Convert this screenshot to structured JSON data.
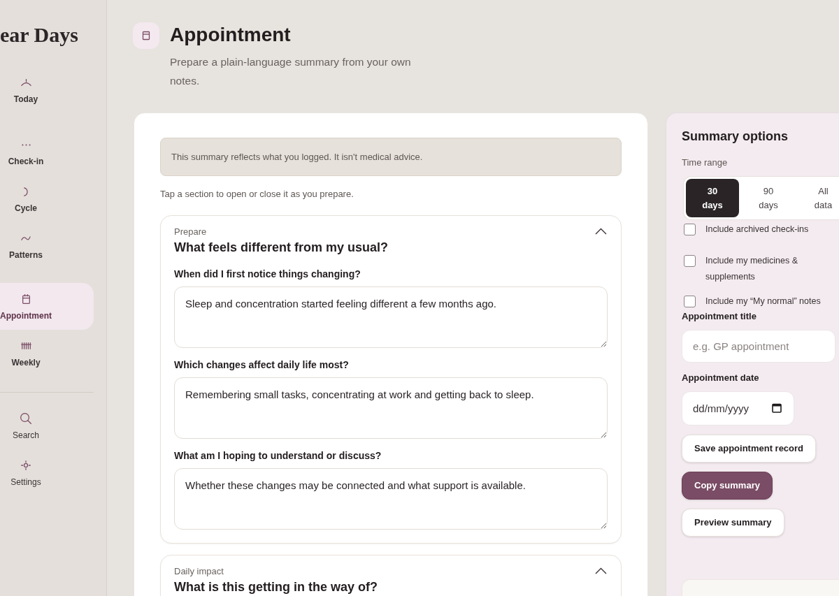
{
  "sidebar": {
    "logo": "ear Days",
    "items": [
      {
        "label": "Today",
        "selected": false
      },
      {
        "label": "Check-in",
        "selected": false
      },
      {
        "label": "Cycle",
        "selected": false
      },
      {
        "label": "Patterns",
        "selected": false
      },
      {
        "label": "Appointment",
        "selected": true
      },
      {
        "label": "Weekly",
        "selected": false
      }
    ],
    "footer_items": [
      {
        "label": "Search"
      },
      {
        "label": "Settings"
      }
    ]
  },
  "header": {
    "title": "Appointment",
    "subtitle": "Prepare a plain-language summary from your own notes."
  },
  "main": {
    "notice": "This summary reflects what you logged. It isn't medical advice.",
    "hint": "Tap a section to open or close it as you prepare.",
    "sections": [
      {
        "eyebrow": "Prepare",
        "title": "What feels different from my usual?",
        "expanded": true,
        "questions": [
          {
            "label": "When did I first notice things changing?",
            "answer": "Sleep and concentration started feeling different a few months ago."
          },
          {
            "label": "Which changes affect daily life most?",
            "answer": "Remembering small tasks, concentrating at work and getting back to sleep."
          },
          {
            "label": "What am I hoping to understand or discuss?",
            "answer": "Whether these changes may be connected and what support is available."
          }
        ]
      },
      {
        "eyebrow": "Daily impact",
        "title": "What is this getting in the way of?",
        "expanded": true
      }
    ]
  },
  "options": {
    "title": "Summary options",
    "time_range": {
      "label": "Time range",
      "options": [
        {
          "label": "30 days",
          "selected": true
        },
        {
          "label": "90 days",
          "selected": false
        },
        {
          "label": "All data",
          "selected": false
        }
      ]
    },
    "checkboxes": [
      {
        "label": "Include archived check-ins",
        "checked": false
      },
      {
        "label": "Include my medicines & supplements",
        "checked": false
      },
      {
        "label": "Include my “My normal” notes",
        "checked": false
      }
    ],
    "title_field": {
      "label": "Appointment title",
      "placeholder": "e.g. GP appointment"
    },
    "date_field": {
      "label": "Appointment date",
      "placeholder": "dd/mm/yyyy"
    },
    "buttons": [
      {
        "label": "Save appointment record",
        "kind": "secondary"
      },
      {
        "label": "Copy summary",
        "kind": "primary"
      },
      {
        "label": "Preview summary",
        "kind": "secondary"
      }
    ]
  }
}
